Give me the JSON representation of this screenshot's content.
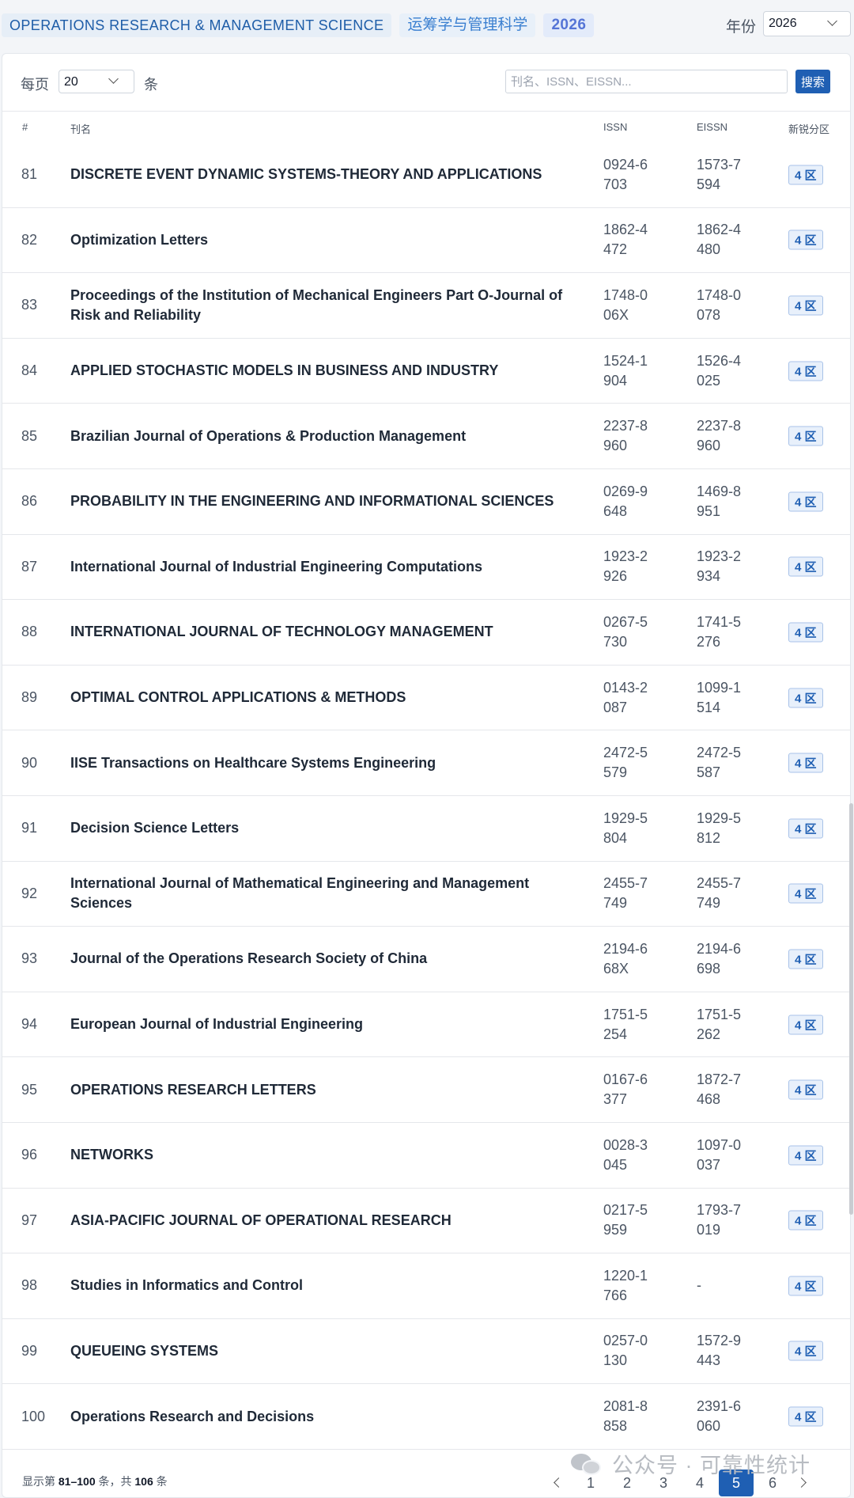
{
  "header": {
    "tag_en": "OPERATIONS RESEARCH & MANAGEMENT SCIENCE",
    "tag_cn": "运筹学与管理科学",
    "tag_year": "2026",
    "year_label": "年份",
    "year_value": "2026"
  },
  "controls": {
    "perpage_label": "每页",
    "perpage_value": "20",
    "perpage_unit": "条",
    "search_placeholder": "刊名、ISSN、EISSN...",
    "search_button": "搜索"
  },
  "table": {
    "columns": {
      "num": "#",
      "title": "刊名",
      "issn": "ISSN",
      "eissn": "EISSN",
      "zone": "新锐分区"
    },
    "rows": [
      {
        "num": "81",
        "title": "DISCRETE EVENT DYNAMIC SYSTEMS-THEORY AND APPLICATIONS",
        "issn": "0924-6703",
        "eissn": "1573-7594",
        "zone": "4 区"
      },
      {
        "num": "82",
        "title": "Optimization Letters",
        "issn": "1862-4472",
        "eissn": "1862-4480",
        "zone": "4 区"
      },
      {
        "num": "83",
        "title": "Proceedings of the Institution of Mechanical Engineers Part O-Journal of Risk and Reliability",
        "issn": "1748-006X",
        "eissn": "1748-0078",
        "zone": "4 区"
      },
      {
        "num": "84",
        "title": "APPLIED STOCHASTIC MODELS IN BUSINESS AND INDUSTRY",
        "issn": "1524-1904",
        "eissn": "1526-4025",
        "zone": "4 区"
      },
      {
        "num": "85",
        "title": "Brazilian Journal of Operations & Production Management",
        "issn": "2237-8960",
        "eissn": "2237-8960",
        "zone": "4 区"
      },
      {
        "num": "86",
        "title": "PROBABILITY IN THE ENGINEERING AND INFORMATIONAL SCIENCES",
        "issn": "0269-9648",
        "eissn": "1469-8951",
        "zone": "4 区"
      },
      {
        "num": "87",
        "title": "International Journal of Industrial Engineering Computations",
        "issn": "1923-2926",
        "eissn": "1923-2934",
        "zone": "4 区"
      },
      {
        "num": "88",
        "title": "INTERNATIONAL JOURNAL OF TECHNOLOGY MANAGEMENT",
        "issn": "0267-5730",
        "eissn": "1741-5276",
        "zone": "4 区"
      },
      {
        "num": "89",
        "title": "OPTIMAL CONTROL APPLICATIONS & METHODS",
        "issn": "0143-2087",
        "eissn": "1099-1514",
        "zone": "4 区"
      },
      {
        "num": "90",
        "title": "IISE Transactions on Healthcare Systems Engineering",
        "issn": "2472-5579",
        "eissn": "2472-5587",
        "zone": "4 区"
      },
      {
        "num": "91",
        "title": "Decision Science Letters",
        "issn": "1929-5804",
        "eissn": "1929-5812",
        "zone": "4 区"
      },
      {
        "num": "92",
        "title": "International Journal of Mathematical Engineering and Management Sciences",
        "issn": "2455-7749",
        "eissn": "2455-7749",
        "zone": "4 区"
      },
      {
        "num": "93",
        "title": "Journal of the Operations Research Society of China",
        "issn": "2194-668X",
        "eissn": "2194-6698",
        "zone": "4 区"
      },
      {
        "num": "94",
        "title": "European Journal of Industrial Engineering",
        "issn": "1751-5254",
        "eissn": "1751-5262",
        "zone": "4 区"
      },
      {
        "num": "95",
        "title": "OPERATIONS RESEARCH LETTERS",
        "issn": "0167-6377",
        "eissn": "1872-7468",
        "zone": "4 区"
      },
      {
        "num": "96",
        "title": "NETWORKS",
        "issn": "0028-3045",
        "eissn": "1097-0037",
        "zone": "4 区"
      },
      {
        "num": "97",
        "title": "ASIA-PACIFIC JOURNAL OF OPERATIONAL RESEARCH",
        "issn": "0217-5959",
        "eissn": "1793-7019",
        "zone": "4 区"
      },
      {
        "num": "98",
        "title": "Studies in Informatics and Control",
        "issn": "1220-1766",
        "eissn": "-",
        "zone": "4 区"
      },
      {
        "num": "99",
        "title": "QUEUEING SYSTEMS",
        "issn": "0257-0130",
        "eissn": "1572-9443",
        "zone": "4 区"
      },
      {
        "num": "100",
        "title": "Operations Research and Decisions",
        "issn": "2081-8858",
        "eissn": "2391-6060",
        "zone": "4 区"
      }
    ]
  },
  "footer": {
    "info_prefix": "显示第 ",
    "range": "81–100",
    "info_mid": " 条，共 ",
    "total": "106",
    "info_suffix": " 条",
    "pages": [
      "1",
      "2",
      "3",
      "4",
      "5",
      "6"
    ],
    "current_page": "5"
  },
  "watermark": {
    "text": "公众号 · 可靠性统计",
    "icon": "wechat-icon"
  }
}
